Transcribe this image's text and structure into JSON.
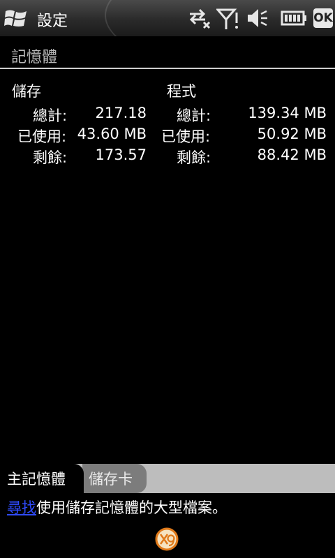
{
  "titlebar": {
    "title": "設定",
    "ok_label": "OK",
    "icons": [
      "windows-start-icon",
      "data-connection-icon",
      "signal-icon",
      "volume-mute-icon",
      "battery-icon"
    ]
  },
  "section": {
    "title": "記憶體"
  },
  "storage": {
    "heading": "儲存",
    "rows": [
      {
        "label": "總計:",
        "value": "217.18"
      },
      {
        "label": "已使用:",
        "value": "43.60 MB"
      },
      {
        "label": "剩餘:",
        "value": "173.57"
      }
    ]
  },
  "program": {
    "heading": "程式",
    "rows": [
      {
        "label": "總計:",
        "value": "139.34 MB"
      },
      {
        "label": "已使用:",
        "value": "50.92 MB"
      },
      {
        "label": "剩餘:",
        "value": "88.42 MB"
      }
    ]
  },
  "tabs": [
    {
      "label": "主記憶體",
      "selected": true
    },
    {
      "label": "儲存卡",
      "selected": false
    }
  ],
  "footer": {
    "link": "尋找",
    "text": "使用儲存記憶體的大型檔案。"
  },
  "colors": {
    "link": "#2f4bff",
    "tab_bar": "#bdbdbd",
    "header_text": "#b9b9b9"
  }
}
